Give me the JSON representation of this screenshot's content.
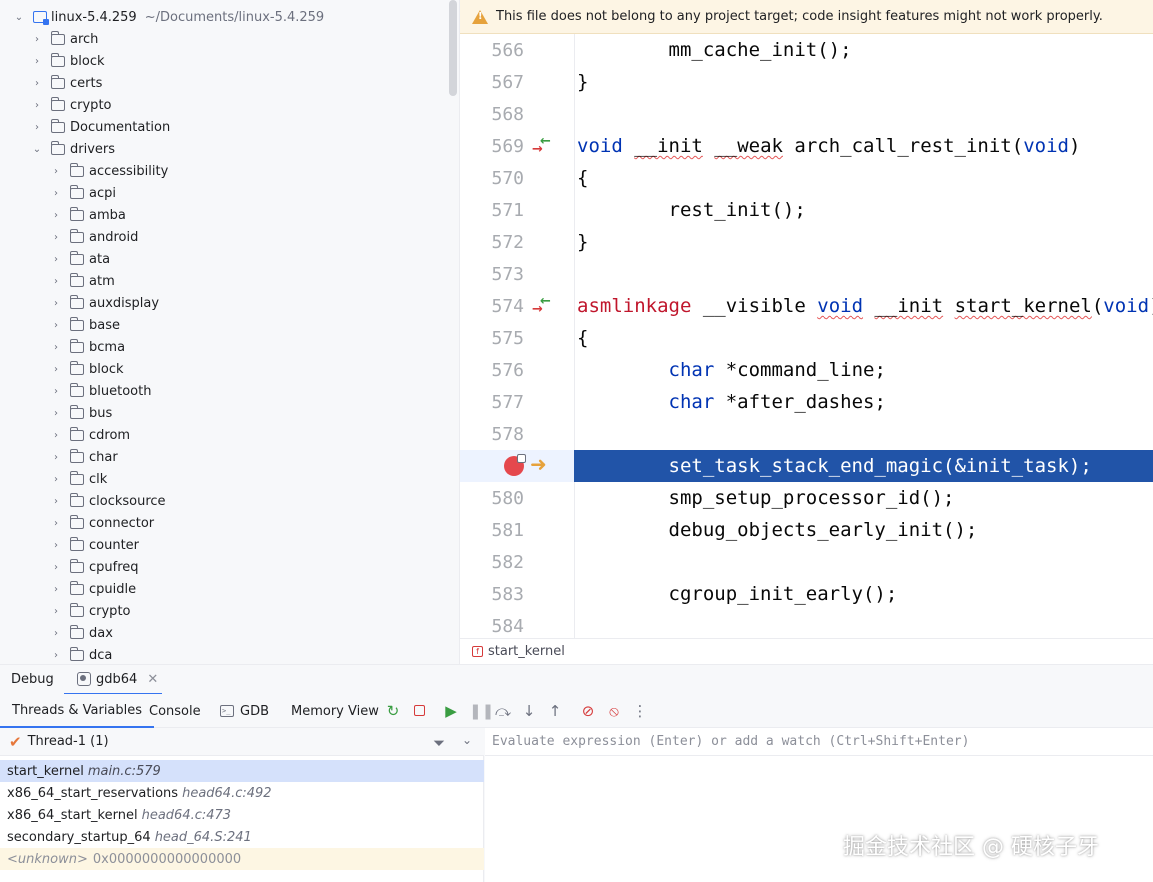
{
  "project": {
    "root_name": "linux-5.4.259",
    "root_path": "~/Documents/linux-5.4.259",
    "top_folders": [
      "arch",
      "block",
      "certs",
      "crypto",
      "Documentation",
      "drivers"
    ],
    "driver_folders": [
      "accessibility",
      "acpi",
      "amba",
      "android",
      "ata",
      "atm",
      "auxdisplay",
      "base",
      "bcma",
      "block",
      "bluetooth",
      "bus",
      "cdrom",
      "char",
      "clk",
      "clocksource",
      "connector",
      "counter",
      "cpufreq",
      "cpuidle",
      "crypto",
      "dax",
      "dca"
    ]
  },
  "editor": {
    "banner": "This file does not belong to any project target; code insight features might not work properly.",
    "breadcrumb": "start_kernel",
    "line_numbers": [
      "566",
      "567",
      "568",
      "569",
      "570",
      "571",
      "572",
      "573",
      "574",
      "575",
      "576",
      "577",
      "578",
      "579",
      "580",
      "581",
      "582",
      "583",
      "584"
    ],
    "code": {
      "l566": "mm_cache_init();",
      "l567": "}",
      "l569_kw1": "void",
      "l569_a": "__init",
      "l569_b": "__weak",
      "l569_c": "arch_call_rest_init(",
      "l569_kw2": "void",
      "l569_d": ")",
      "l570": "{",
      "l571": "rest_init();",
      "l572": "}",
      "l574_a": "asmlinkage",
      "l574_b": "__visible",
      "l574_kw1": "void",
      "l574_c": "__init",
      "l574_d": "start_kernel",
      "l574_e": "(",
      "l574_kw2": "void",
      "l574_f": ")",
      "l575": "{",
      "l576_kw": "char",
      "l576_rest": "*command_line;",
      "l577_kw": "char",
      "l577_rest": "*after_dashes;",
      "l579": "set_task_stack_end_magic(&init_task);",
      "l580": "smp_setup_processor_id();",
      "l581": "debug_objects_early_init();",
      "l583": "cgroup_init_early();"
    }
  },
  "debug": {
    "title": "Debug",
    "session_tab": "gdb64",
    "tabs": [
      "Threads & Variables",
      "Console",
      "GDB",
      "Memory View"
    ],
    "thread": "Thread-1 (1)",
    "frames": [
      {
        "fn": "start_kernel",
        "loc": "main.c:579"
      },
      {
        "fn": "x86_64_start_reservations",
        "loc": "head64.c:492"
      },
      {
        "fn": "x86_64_start_kernel",
        "loc": "head64.c:473"
      },
      {
        "fn": "secondary_startup_64",
        "loc": "head_64.S:241"
      }
    ],
    "unknown_frame": {
      "name": "<unknown>",
      "addr": "0x0000000000000000"
    },
    "watch_placeholder": "Evaluate expression (Enter) or add a watch (Ctrl+Shift+Enter)"
  },
  "watermark": "掘金技术社区 @ 硬核子牙",
  "colors": {
    "accent": "#3574f0",
    "exec_line": "#2154a8",
    "keyword": "#0033b3",
    "macro_red": "#c0162c",
    "breakpoint": "#e5484d"
  }
}
